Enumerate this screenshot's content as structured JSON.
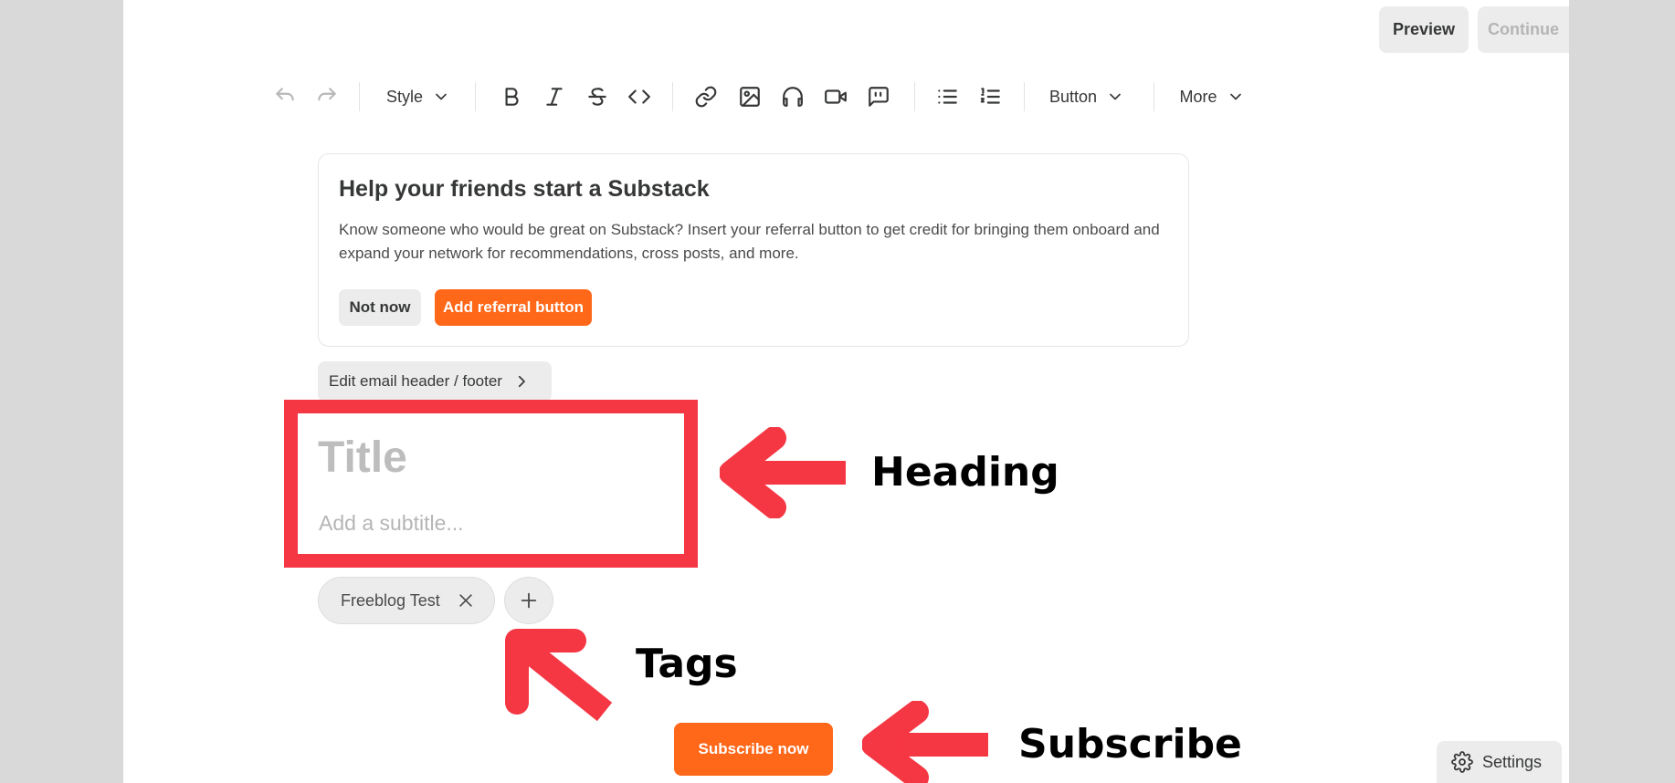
{
  "header": {
    "preview_label": "Preview",
    "continue_label": "Continue"
  },
  "toolbar": {
    "style_label": "Style",
    "button_label": "Button",
    "more_label": "More",
    "icons": [
      "undo-icon",
      "redo-icon",
      "bold-icon",
      "italic-icon",
      "strikethrough-icon",
      "code-icon",
      "link-icon",
      "image-icon",
      "audio-icon",
      "video-icon",
      "quote-icon",
      "bullet-list-icon",
      "numbered-list-icon"
    ]
  },
  "referral_card": {
    "title": "Help your friends start a Substack",
    "body": "Know someone who would be great on Substack? Insert your referral button to get credit for bringing them onboard and expand your network for recommendations, cross posts, and more.",
    "not_now_label": "Not now",
    "add_label": "Add referral button"
  },
  "edit_email_label": "Edit email header / footer",
  "post": {
    "title_placeholder": "Title",
    "subtitle_placeholder": "Add a subtitle..."
  },
  "tags": [
    {
      "label": "Freeblog Test"
    }
  ],
  "subscribe_label": "Subscribe now",
  "settings_label": "Settings",
  "annotations": {
    "heading": "Heading",
    "tags": "Tags",
    "subscribe": "Subscribe",
    "color": "#f53643"
  },
  "colors": {
    "accent": "#ff6719",
    "annotation": "#f53643"
  }
}
